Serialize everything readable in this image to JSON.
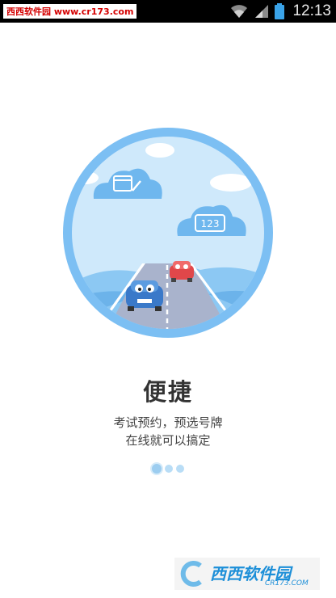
{
  "status_bar": {
    "watermark": "西西软件园 www.cr173.com",
    "time": "12:13"
  },
  "onboarding": {
    "title": "便捷",
    "subtitle_line1": "考试预约，预选号牌",
    "subtitle_line2": "在线就可以搞定",
    "pager": {
      "total": 3,
      "current": 1
    },
    "plate_text": "123"
  },
  "watermark_bottom": {
    "brand": "西西软件园",
    "domain": "CR173.COM"
  },
  "colors": {
    "circle_border": "#7cbff3",
    "sky": "#cfe9fb",
    "road": "#a9b3cc",
    "accent_blue": "#1d8fd8"
  }
}
